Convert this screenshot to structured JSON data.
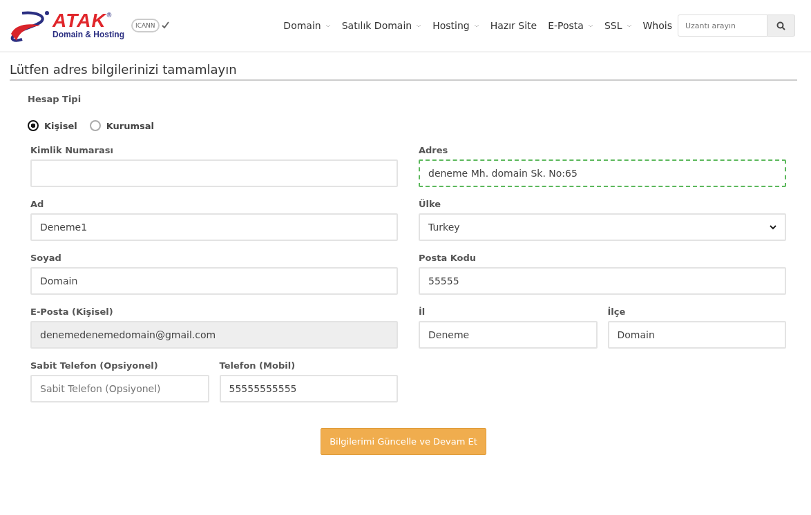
{
  "logo": {
    "name": "ATAK",
    "registered": "®",
    "tagline": "Domain & Hosting",
    "seal": "ICANN"
  },
  "nav": [
    {
      "label": "Domain",
      "dropdown": true
    },
    {
      "label": "Satılık Domain",
      "dropdown": true
    },
    {
      "label": "Hosting",
      "dropdown": true
    },
    {
      "label": "Hazır Site",
      "dropdown": false
    },
    {
      "label": "E-Posta",
      "dropdown": true
    },
    {
      "label": "SSL",
      "dropdown": true
    },
    {
      "label": "Whois",
      "dropdown": false
    }
  ],
  "search": {
    "placeholder": "Uzantı arayın"
  },
  "title": "Lütfen adres bilgilerinizi tamamlayın",
  "account_type": {
    "label": "Hesap Tipi",
    "options": [
      {
        "label": "Kişisel",
        "selected": true
      },
      {
        "label": "Kurumsal",
        "selected": false
      }
    ]
  },
  "left": [
    [
      {
        "kind": "input",
        "label": "Kimlik Numarası"
      }
    ],
    [
      {
        "kind": "input",
        "label": "Ad",
        "value": "Deneme1"
      }
    ],
    [
      {
        "kind": "input",
        "label": "Soyad",
        "value": "Domain"
      }
    ],
    [
      {
        "kind": "input",
        "label": "E-Posta (Kişisel)",
        "value": "denemedenemedomain@gmail.com",
        "disabled": true
      }
    ],
    [
      {
        "kind": "input",
        "label": "Sabit Telefon (Opsiyonel)",
        "placeholder": "Sabit Telefon (Opsiyonel)"
      },
      {
        "kind": "input",
        "label": "Telefon (Mobil)",
        "value": "55555555555"
      }
    ]
  ],
  "right": [
    [
      {
        "kind": "input",
        "label": "Adres",
        "value": "deneme Mh. domain Sk. No:65",
        "focused": true
      }
    ],
    [
      {
        "kind": "select",
        "label": "Ülke",
        "value": "Turkey"
      }
    ],
    [
      {
        "kind": "input",
        "label": "Posta Kodu",
        "value": "55555"
      }
    ],
    [
      {
        "kind": "input",
        "label": "İl",
        "value": "Deneme"
      },
      {
        "kind": "input",
        "label": "İlçe",
        "value": "Domain"
      }
    ]
  ],
  "submit": "Bilgilerimi Güncelle ve Devam Et"
}
